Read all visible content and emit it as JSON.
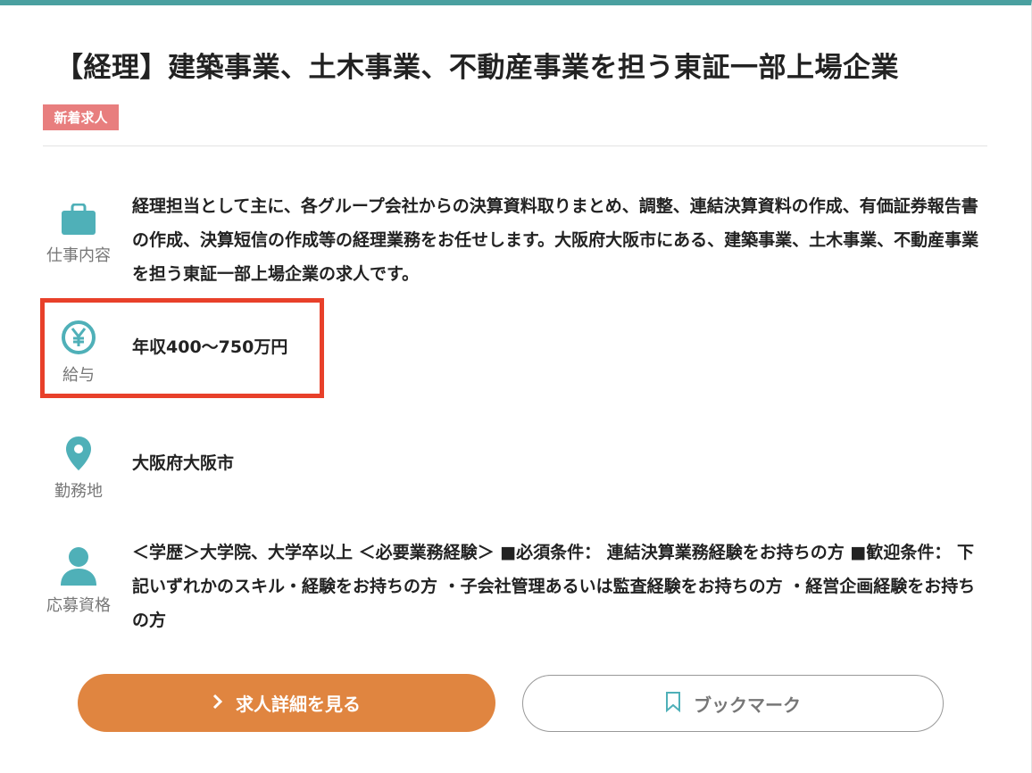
{
  "job": {
    "title": "【経理】建築事業、土木事業、不動産事業を担う東証一部上場企業",
    "badge": "新着求人"
  },
  "details": [
    {
      "label": "仕事内容",
      "icon": "briefcase-icon",
      "text": "経理担当として主に、各グループ会社からの決算資料取りまとめ、調整、連結決算資料の作成、有価証券報告書の作成、決算短信の作成等の経理業務をお任せします。大阪府大阪市にある、建築事業、土木事業、不動産事業を担う東証一部上場企業の求人です。"
    },
    {
      "label": "給与",
      "icon": "yen-icon",
      "text": "年収400〜750万円"
    },
    {
      "label": "勤務地",
      "icon": "location-pin-icon",
      "text": "大阪府大阪市"
    },
    {
      "label": "応募資格",
      "icon": "person-icon",
      "text": "＜学歴＞大学院、大学卒以上 ＜必要業務経験＞ ■必須条件： 連結決算業務経験をお持ちの方 ■歓迎条件： 下記いずれかのスキル・経験をお持ちの方 ・子会社管理あるいは監査経験をお持ちの方 ・経営企画経験をお持ちの方"
    }
  ],
  "buttons": {
    "detail_label": "求人詳細を見る",
    "bookmark_label": "ブックマーク"
  },
  "colors": {
    "accent_teal": "#4aa0a0",
    "badge_red": "#e87e7e",
    "highlight_red": "#e8402a",
    "primary_orange": "#e08540"
  }
}
